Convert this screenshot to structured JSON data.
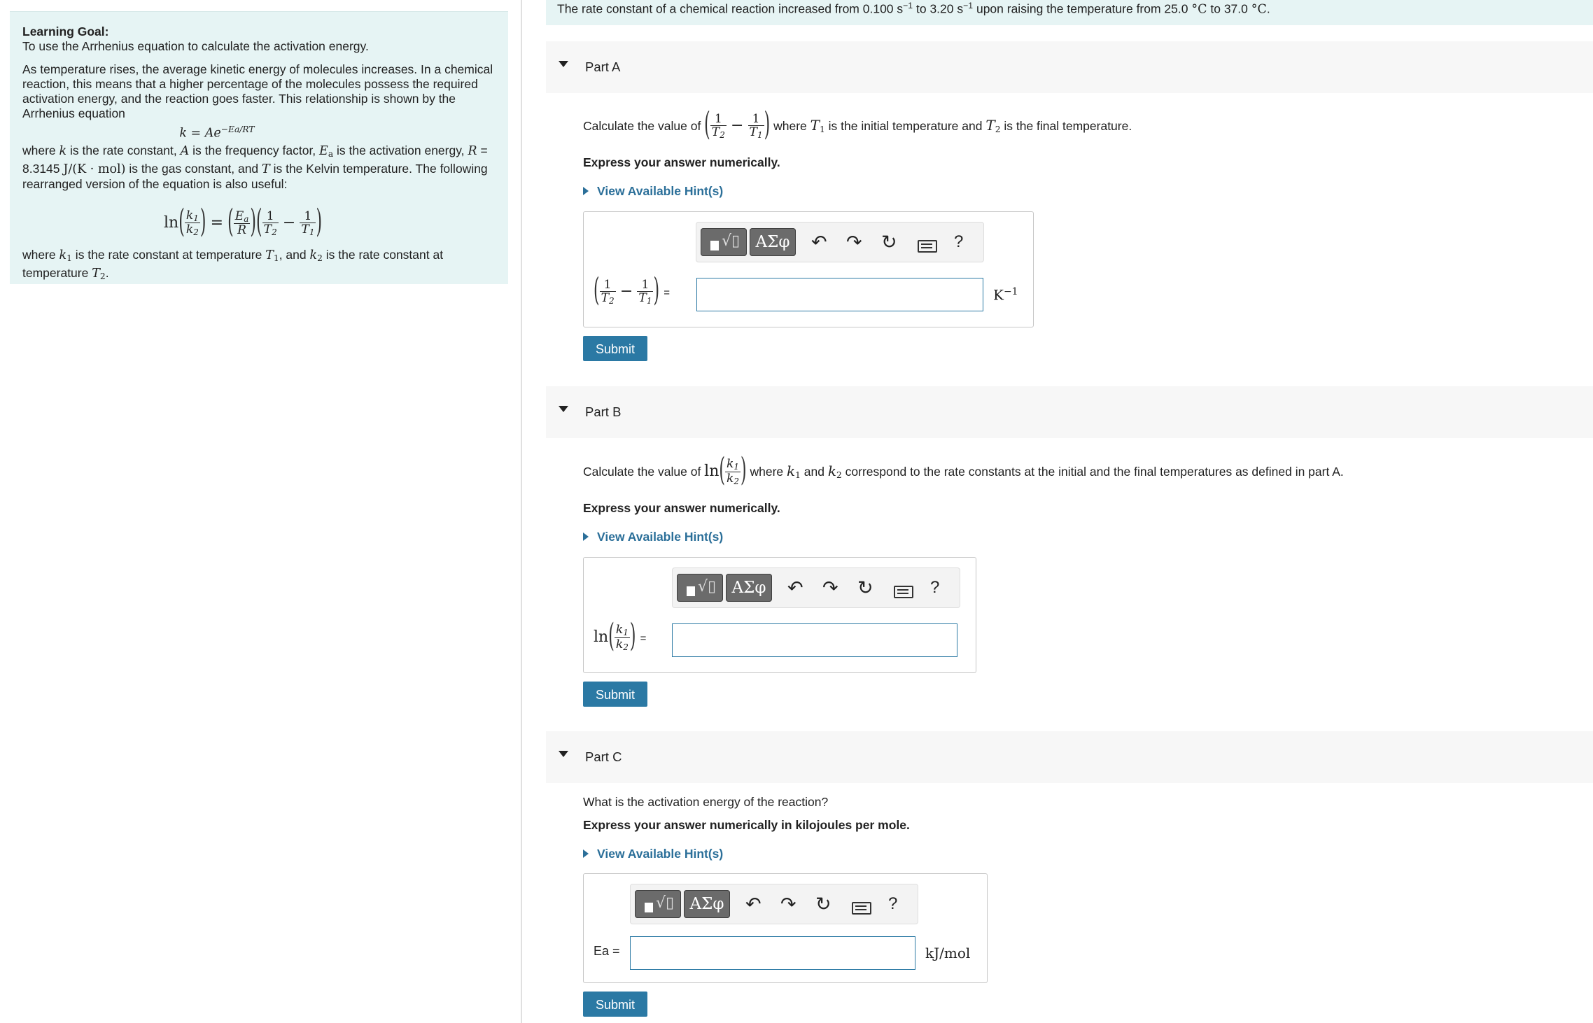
{
  "problem": {
    "text_1": "The rate constant of a chemical reaction increased from 0.100 s",
    "exp": "−1",
    "text_2": " to 3.20 s",
    "text_3": " upon raising the temperature from 25.0 ",
    "deg": "°C",
    "text_4": " to 37.0 ",
    "text_5": "."
  },
  "learning_goal": {
    "heading": "Learning Goal:",
    "goal": "To use the Arrhenius equation to calculate the activation energy.",
    "para1": "As temperature rises, the average kinetic energy of molecules increases. In a chemical reaction, this means that a higher percentage of the molecules possess the required activation energy, and the reaction goes faster. This relationship is shown by the Arrhenius equation",
    "eq_lhs": "k = Ae",
    "eq_exp": "−Ea/RT",
    "where1_a": "where ",
    "where1_b": " is the rate constant, ",
    "where1_c": " is the frequency factor, ",
    "where1_d": " is the activation energy, ",
    "where1_e": " = 8.3145 ",
    "where1_unit": "J/(K · mol)",
    "where1_f": " is the gas constant, and ",
    "where1_g": " is the Kelvin temperature. The following rearranged version of the equation is also useful:",
    "where2_a": "where ",
    "where2_b": " is the rate constant at temperature ",
    "where2_c": ", and ",
    "where2_d": " is the rate constant at temperature ",
    "where2_e": "."
  },
  "parts": [
    {
      "title": "Part A",
      "question_pre": "Calculate the value of ",
      "question_post_1": " where ",
      "question_post_2": " is the initial temperature and ",
      "question_post_3": " is the final temperature.",
      "instruction": "Express your answer numerically.",
      "hint": "View Available Hint(s)",
      "unit": "K",
      "unit_exp": "−1",
      "input_value": "",
      "submit": "Submit"
    },
    {
      "title": "Part B",
      "question_pre": "Calculate the value of ",
      "question_post_1": " where ",
      "question_post_2": " and ",
      "question_post_3": " correspond to the rate constants at the initial and the final temperatures as defined in part A.",
      "instruction": "Express your answer numerically.",
      "hint": "View Available Hint(s)",
      "input_value": "",
      "submit": "Submit"
    },
    {
      "title": "Part C",
      "question": "What is the activation energy of the reaction?",
      "instruction": "Express your answer numerically in kilojoules per mole.",
      "hint": "View Available Hint(s)",
      "label": "Ea =",
      "unit": "kJ/mol",
      "input_value": "",
      "submit": "Submit"
    }
  ],
  "toolbar": {
    "symbols": "ΑΣφ",
    "help": "?",
    "undo": "↶",
    "redo": "↷",
    "reset": "↻"
  }
}
